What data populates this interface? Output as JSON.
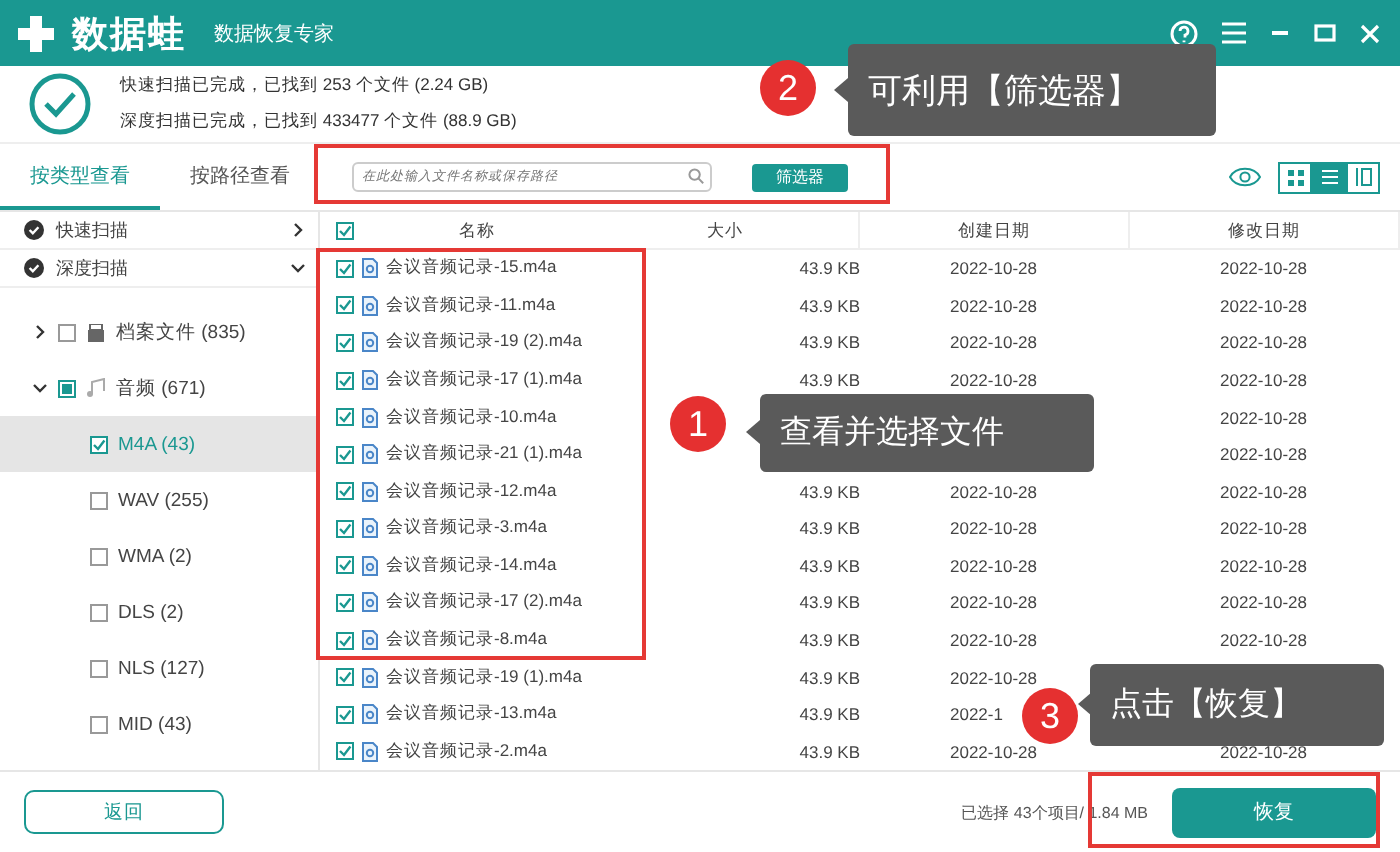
{
  "app": {
    "logo": "数据蛙",
    "subtitle": "数据恢复专家"
  },
  "scan_summary": [
    "快速扫描已完成，已找到 253 个文件 (2.24 GB)",
    "深度扫描已完成，已找到 433477 个文件 (88.9 GB)"
  ],
  "view_tabs": [
    {
      "label": "按类型查看",
      "selected": true
    },
    {
      "label": "按路径查看",
      "selected": false
    }
  ],
  "search": {
    "placeholder": "在此处输入文件名称或保存路径"
  },
  "filter_button": "筛选器",
  "view_modes": [
    {
      "kind": "grid",
      "selected": false
    },
    {
      "kind": "list",
      "selected": true
    },
    {
      "kind": "preview",
      "selected": false
    }
  ],
  "sidebar": {
    "scans": [
      {
        "label": "快速扫描",
        "expanded": false
      },
      {
        "label": "深度扫描",
        "expanded": true
      }
    ],
    "tree": [
      {
        "label": "档案文件 (835)",
        "expanded": false,
        "checked": false,
        "partial": false,
        "selected": false
      },
      {
        "label": "音频 (671)",
        "expanded": true,
        "checked": false,
        "partial": true,
        "selected": false,
        "children": [
          {
            "label": "M4A (43)",
            "checked": true,
            "selected": true
          },
          {
            "label": "WAV (255)",
            "checked": false,
            "selected": false
          },
          {
            "label": "WMA (2)",
            "checked": false,
            "selected": false
          },
          {
            "label": "DLS (2)",
            "checked": false,
            "selected": false
          },
          {
            "label": "NLS (127)",
            "checked": false,
            "selected": false
          },
          {
            "label": "MID (43)",
            "checked": false,
            "selected": false
          }
        ]
      }
    ]
  },
  "table": {
    "columns": [
      "名称",
      "大小",
      "创建日期",
      "修改日期"
    ],
    "all_checked": true,
    "rows": [
      {
        "name": "会议音频记录-15.m4a",
        "size": "43.9 KB",
        "created": "2022-10-28",
        "modified": "2022-10-28",
        "checked": true
      },
      {
        "name": "会议音频记录-11.m4a",
        "size": "43.9 KB",
        "created": "2022-10-28",
        "modified": "2022-10-28",
        "checked": true
      },
      {
        "name": "会议音频记录-19 (2).m4a",
        "size": "43.9 KB",
        "created": "2022-10-28",
        "modified": "2022-10-28",
        "checked": true
      },
      {
        "name": "会议音频记录-17 (1).m4a",
        "size": "43.9 KB",
        "created": "2022-10-28",
        "modified": "2022-10-28",
        "checked": true
      },
      {
        "name": "会议音频记录-10.m4a",
        "modified": "2022-10-28",
        "checked": true
      },
      {
        "name": "会议音频记录-21 (1).m4a",
        "modified": "2022-10-28",
        "checked": true
      },
      {
        "name": "会议音频记录-12.m4a",
        "size": "43.9 KB",
        "created": "2022-10-28",
        "modified": "2022-10-28",
        "checked": true
      },
      {
        "name": "会议音频记录-3.m4a",
        "size": "43.9 KB",
        "created": "2022-10-28",
        "modified": "2022-10-28",
        "checked": true
      },
      {
        "name": "会议音频记录-14.m4a",
        "size": "43.9 KB",
        "created": "2022-10-28",
        "modified": "2022-10-28",
        "checked": true
      },
      {
        "name": "会议音频记录-17 (2).m4a",
        "size": "43.9 KB",
        "created": "2022-10-28",
        "modified": "2022-10-28",
        "checked": true
      },
      {
        "name": "会议音频记录-8.m4a",
        "size": "43.9 KB",
        "created": "2022-10-28",
        "modified": "2022-10-28",
        "checked": true
      },
      {
        "name": "会议音频记录-19 (1).m4a",
        "size": "43.9 KB",
        "created": "2022-10-28",
        "checked": true
      },
      {
        "name": "会议音频记录-13.m4a",
        "size": "43.9 KB",
        "created": "2022-1",
        "checked": true
      },
      {
        "name": "会议音频记录-2.m4a",
        "size": "43.9 KB",
        "created": "2022-10-28",
        "modified": "2022-10-28",
        "checked": true
      }
    ]
  },
  "footer": {
    "back_button": "返回",
    "status": "已选择 43个项目/ 1.84 MB",
    "recover_button": "恢复"
  },
  "callouts": [
    {
      "number": "2",
      "text": "可利用【筛选器】"
    },
    {
      "number": "1",
      "text": "查看并选择文件"
    },
    {
      "number": "3",
      "text": "点击【恢复】"
    }
  ]
}
